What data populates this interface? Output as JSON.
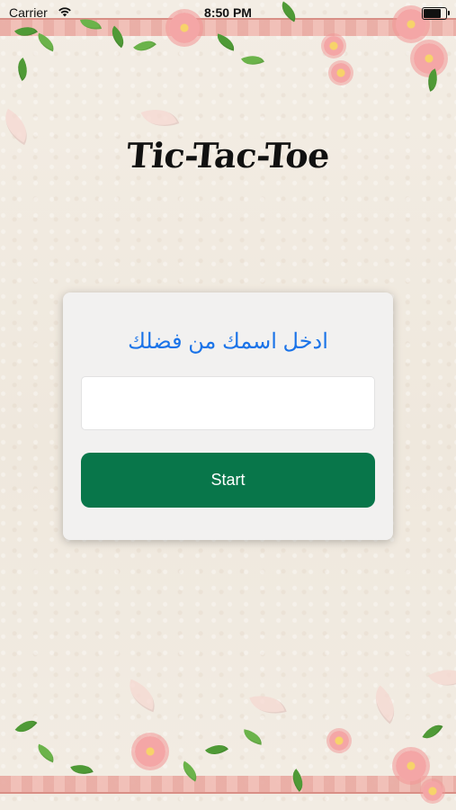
{
  "status_bar": {
    "carrier": "Carrier",
    "time": "8:50 PM",
    "battery_level": 0.9
  },
  "app": {
    "title": "Tic-Tac-Toe"
  },
  "form": {
    "prompt": "ادخل اسمك من فضلك",
    "name_value": "",
    "start_label": "Start"
  },
  "colors": {
    "accent_text": "#1a73e8",
    "start_button": "#08764a",
    "background": "#f1ebe1"
  },
  "icons": [
    "wifi-icon",
    "battery-icon"
  ]
}
